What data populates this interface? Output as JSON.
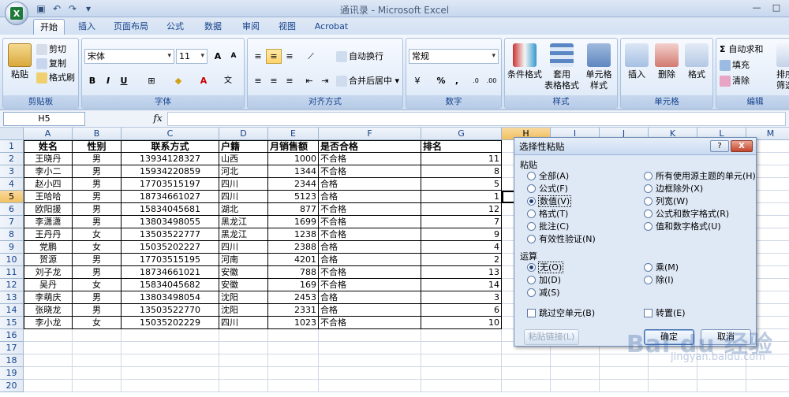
{
  "window": {
    "title": "通讯录 - Microsoft Excel"
  },
  "tabs": [
    "开始",
    "插入",
    "页面布局",
    "公式",
    "数据",
    "审阅",
    "视图",
    "Acrobat"
  ],
  "ribbon": {
    "clipboard": {
      "paste": "粘贴",
      "cut": "剪切",
      "copy": "复制",
      "format_painter": "格式刷",
      "label": "剪贴板"
    },
    "font": {
      "name": "宋体",
      "size": "11",
      "label": "字体",
      "grow": "A",
      "shrink": "A",
      "bold": "B",
      "italic": "I",
      "underline": "U"
    },
    "align": {
      "wrap": "自动换行",
      "merge": "合并后居中",
      "label": "对齐方式"
    },
    "number": {
      "format": "常规",
      "percent": "%",
      "comma": ",",
      "label": "数字"
    },
    "styles": {
      "cond": "条件格式",
      "table": "套用\n表格格式",
      "cell": "单元格\n样式",
      "label": "样式"
    },
    "cells": {
      "insert": "插入",
      "delete": "删除",
      "format": "格式",
      "label": "单元格"
    },
    "edit": {
      "autosum": "自动求和",
      "fill": "填充",
      "clear": "清除",
      "sort": "排序\n筛选",
      "label": "编辑"
    }
  },
  "formula_bar": {
    "name_box": "H5",
    "fx": "fx",
    "value": ""
  },
  "columns": [
    "A",
    "B",
    "C",
    "D",
    "E",
    "F",
    "G",
    "H",
    "I",
    "J",
    "K",
    "L",
    "M"
  ],
  "selected_col": "H",
  "selected_row": 5,
  "header_row": [
    "姓名",
    "性别",
    "联系方式",
    "户籍",
    "月销售额",
    "是否合格",
    "排名"
  ],
  "rows": [
    [
      "王晓丹",
      "男",
      "13934128327",
      "山西",
      "1000",
      "不合格",
      "11"
    ],
    [
      "李小二",
      "男",
      "15934220859",
      "河北",
      "1344",
      "不合格",
      "8"
    ],
    [
      "赵小四",
      "男",
      "17703515197",
      "四川",
      "2344",
      "合格",
      "5"
    ],
    [
      "王哈哈",
      "男",
      "18734661027",
      "四川",
      "5123",
      "合格",
      "1"
    ],
    [
      "欧阳援",
      "男",
      "15834045681",
      "湖北",
      "877",
      "不合格",
      "12"
    ],
    [
      "李潇潇",
      "男",
      "13803498055",
      "黑龙江",
      "1699",
      "不合格",
      "7"
    ],
    [
      "王丹丹",
      "女",
      "13503522777",
      "黑龙江",
      "1238",
      "不合格",
      "9"
    ],
    [
      "党鹏",
      "女",
      "15035202227",
      "四川",
      "2388",
      "合格",
      "4"
    ],
    [
      "贺源",
      "男",
      "17703515195",
      "河南",
      "4201",
      "合格",
      "2"
    ],
    [
      "刘子龙",
      "男",
      "18734661021",
      "安徽",
      "788",
      "不合格",
      "13"
    ],
    [
      "吴丹",
      "女",
      "15834045682",
      "安徽",
      "169",
      "不合格",
      "14"
    ],
    [
      "李萌庆",
      "男",
      "13803498054",
      "沈阳",
      "2453",
      "合格",
      "3"
    ],
    [
      "张晓龙",
      "男",
      "13503522770",
      "沈阳",
      "2331",
      "合格",
      "6"
    ],
    [
      "李小龙",
      "女",
      "15035202229",
      "四川",
      "1023",
      "不合格",
      "10"
    ]
  ],
  "row_numbers": [
    "1",
    "2",
    "3",
    "4",
    "5",
    "6",
    "7",
    "8",
    "9",
    "10",
    "11",
    "12",
    "13",
    "14",
    "15",
    "16",
    "17",
    "18",
    "19",
    "20"
  ],
  "dialog": {
    "title": "选择性粘贴",
    "help": "?",
    "close": "X",
    "paste_section": "粘贴",
    "paste_left": [
      "全部(A)",
      "公式(F)",
      "数值(V)",
      "格式(T)",
      "批注(C)",
      "有效性验证(N)"
    ],
    "paste_right": [
      "所有使用源主题的单元(H)",
      "边框除外(X)",
      "列宽(W)",
      "公式和数字格式(R)",
      "值和数字格式(U)"
    ],
    "paste_selected": "数值(V)",
    "op_section": "运算",
    "op_left": [
      "无(O)",
      "加(D)",
      "减(S)"
    ],
    "op_right": [
      "乘(M)",
      "除(I)"
    ],
    "op_selected": "无(O)",
    "skip_blanks": "跳过空单元(B)",
    "transpose": "转置(E)",
    "paste_link": "粘贴链接(L)",
    "ok": "确定",
    "cancel": "取消"
  },
  "watermark": {
    "main": "Bai du 经验",
    "sub": "jingyan.baidu.com"
  }
}
